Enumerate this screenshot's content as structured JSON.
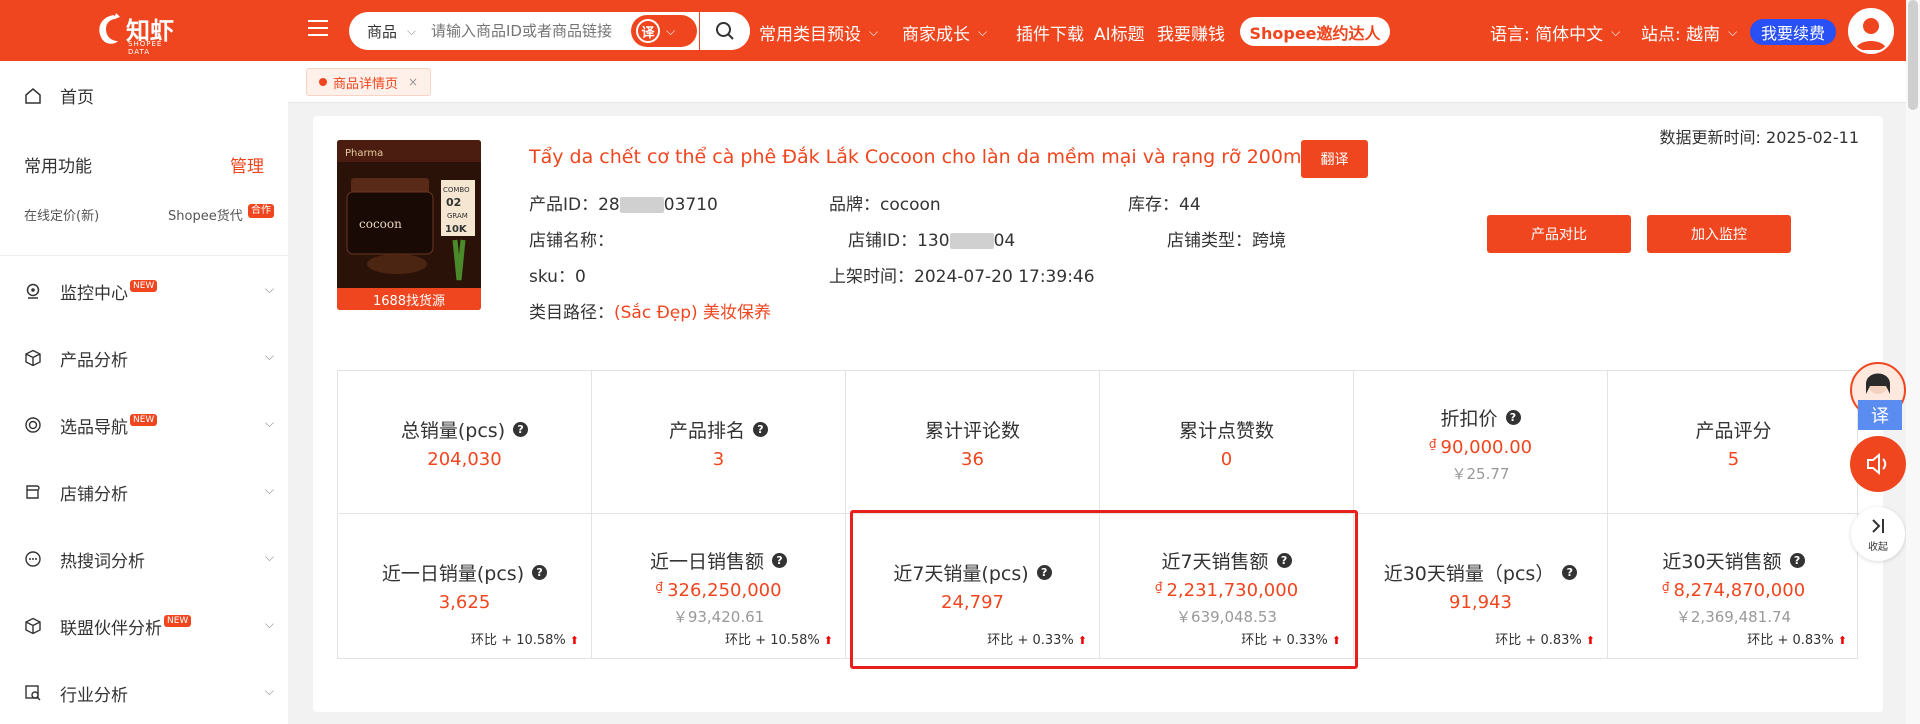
{
  "header": {
    "logo_text": "知虾",
    "logo_sub": "SHOPEE DATA",
    "search": {
      "category": "商品",
      "placeholder": "请输入商品ID或者商品链接",
      "translate_icon": "译"
    },
    "nav": [
      {
        "label": "常用类目预设",
        "dropdown": true
      },
      {
        "label": "商家成长",
        "dropdown": true
      },
      {
        "label": "插件下载",
        "dropdown": false
      },
      {
        "label": "AI标题",
        "dropdown": false
      },
      {
        "label": "我要赚钱",
        "dropdown": false
      }
    ],
    "invite_label": "Shopee邀约达人",
    "language": "语言: 简体中文",
    "site": "站点: 越南",
    "renew_label": "我要续费"
  },
  "sidebar": {
    "home": "首页",
    "common_title": "常用功能",
    "manage": "管理",
    "tools": [
      "在线定价(新)",
      "Shopee货代"
    ],
    "coop_badge": "合作",
    "new_badge": "NEW",
    "items": [
      {
        "label": "监控中心",
        "new": true
      },
      {
        "label": "产品分析",
        "new": false
      },
      {
        "label": "选品导航",
        "new": true
      },
      {
        "label": "店铺分析",
        "new": false
      },
      {
        "label": "热搜词分析",
        "new": false
      },
      {
        "label": "联盟伙伴分析",
        "new": true
      },
      {
        "label": "行业分析",
        "new": false
      }
    ]
  },
  "tabs": [
    {
      "label": "商品详情页",
      "close": "×"
    }
  ],
  "product": {
    "update_time": "数据更新时间: 2025-02-11",
    "title": "Tẩy da chết cơ thể cà phê Đắk Lắk Cocoon cho làn da mềm mại và rạng rỡ 200ml",
    "translate": "翻译",
    "image_bar": "1688找货源",
    "image_brand": "Pharma",
    "image_name": "cocoon",
    "image_combo": "COMBO",
    "image_combo_num": "02",
    "image_gram": "GRAM",
    "image_gram_num": "10K",
    "product_id_label": "产品ID：",
    "product_id_a": "28",
    "product_id_b": "03710",
    "brand_label": "品牌：",
    "brand": "cocoon",
    "stock_label": "库存：",
    "stock": "44",
    "shop_name_label": "店铺名称：",
    "shop_id_label": "店铺ID：",
    "shop_id_a": "130",
    "shop_id_b": "04",
    "shop_type_label": "店铺类型：",
    "shop_type": "跨境",
    "sku_label": "sku：",
    "sku": "0",
    "listed_label": "上架时间：",
    "listed": "2024-07-20 17:39:46",
    "category_label": "类目路径：",
    "category": "(Sắc Đẹp) 美妆保养",
    "compare_btn": "产品对比",
    "monitor_btn": "加入监控"
  },
  "stats_row1": [
    {
      "label": "总销量(pcs)",
      "help": true,
      "value": "204,030"
    },
    {
      "label": "产品排名",
      "help": true,
      "value": "3"
    },
    {
      "label": "累计评论数",
      "help": false,
      "value": "36"
    },
    {
      "label": "累计点赞数",
      "help": false,
      "value": "0"
    },
    {
      "label": "折扣价",
      "help": true,
      "currency": "₫",
      "value": "90,000.00",
      "cny": "￥25.77"
    },
    {
      "label": "产品评分",
      "help": false,
      "value": "5"
    }
  ],
  "stats_row2": [
    {
      "label": "近一日销量(pcs)",
      "help": true,
      "value": "3,625",
      "ratio_label": "环比",
      "ratio": "+ 10.58%"
    },
    {
      "label": "近一日销售额",
      "help": true,
      "currency": "₫",
      "value": "326,250,000",
      "cny": "￥93,420.61",
      "ratio_label": "环比",
      "ratio": "+ 10.58%"
    },
    {
      "label": "近7天销量(pcs)",
      "help": true,
      "value": "24,797",
      "ratio_label": "环比",
      "ratio": "+ 0.33%"
    },
    {
      "label": "近7天销售额",
      "help": true,
      "currency": "₫",
      "value": "2,231,730,000",
      "cny": "￥639,048.53",
      "ratio_label": "环比",
      "ratio": "+ 0.33%"
    },
    {
      "label": "近30天销量（pcs）",
      "help": true,
      "value": "91,943",
      "ratio_label": "环比",
      "ratio": "+ 0.83%"
    },
    {
      "label": "近30天销售额",
      "help": true,
      "currency": "₫",
      "value": "8,274,870,000",
      "cny": "￥2,369,481.74",
      "ratio_label": "环比",
      "ratio": "+ 0.83%"
    }
  ],
  "float": {
    "translate": "译",
    "collapse": "收起"
  },
  "colors": {
    "brand": "#f0461f",
    "renew": "#2950f5",
    "highlight": "#e8201c"
  }
}
